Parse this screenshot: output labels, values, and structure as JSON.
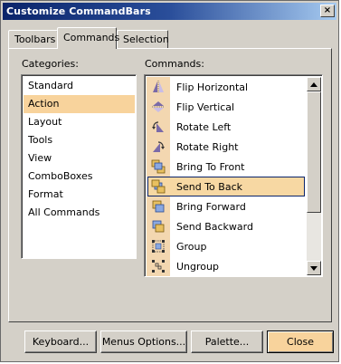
{
  "window": {
    "title": "Customize CommandBars",
    "close_glyph": "×"
  },
  "tabs": [
    {
      "label": "Toolbars",
      "active": false
    },
    {
      "label": "Commands",
      "active": true
    },
    {
      "label": "Selection",
      "active": false
    }
  ],
  "categories": {
    "label": "Categories:",
    "selected_index": 1,
    "items": [
      "Standard",
      "Action",
      "Layout",
      "Tools",
      "View",
      "ComboBoxes",
      "Format",
      "All Commands"
    ]
  },
  "commands": {
    "label": "Commands:",
    "selected_index": 5,
    "items": [
      {
        "label": "Flip Horizontal",
        "icon": "flip-horizontal-icon"
      },
      {
        "label": "Flip Vertical",
        "icon": "flip-vertical-icon"
      },
      {
        "label": "Rotate Left",
        "icon": "rotate-left-icon"
      },
      {
        "label": "Rotate Right",
        "icon": "rotate-right-icon"
      },
      {
        "label": "Bring To Front",
        "icon": "bring-to-front-icon"
      },
      {
        "label": "Send To Back",
        "icon": "send-to-back-icon"
      },
      {
        "label": "Bring Forward",
        "icon": "bring-forward-icon"
      },
      {
        "label": "Send Backward",
        "icon": "send-backward-icon"
      },
      {
        "label": "Group",
        "icon": "group-icon"
      },
      {
        "label": "Ungroup",
        "icon": "ungroup-icon"
      }
    ]
  },
  "buttons": {
    "keyboard": "Keyboard...",
    "menus_options": "Menus Options...",
    "palette": "Palette...",
    "close": "Close"
  },
  "colors": {
    "accent": "#f8d39c",
    "icon_column": "#f3d7b0",
    "title_bar": "#0a246a"
  }
}
